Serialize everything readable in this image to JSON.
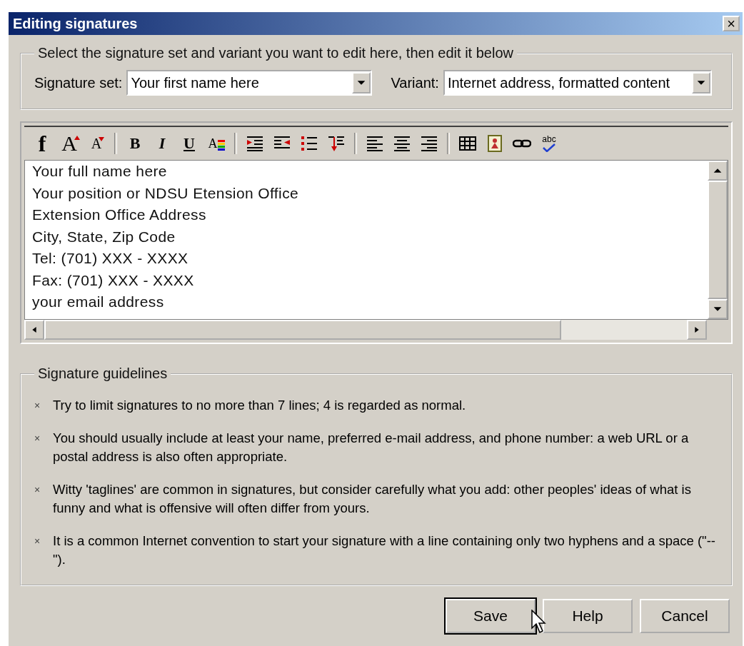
{
  "window": {
    "title": "Editing signatures",
    "close": "×"
  },
  "selection": {
    "legend": "Select the signature set and variant you want to edit here, then edit it below",
    "set_label": "Signature set:",
    "set_value": "Your first name here",
    "variant_label": "Variant:",
    "variant_value": "Internet address, formatted content"
  },
  "toolbar": [
    {
      "kind": "font",
      "label": "f"
    },
    {
      "kind": "grow",
      "label": "A"
    },
    {
      "kind": "shrink",
      "label": "A"
    },
    {
      "kind": "sep"
    },
    {
      "kind": "bold",
      "label": "B"
    },
    {
      "kind": "italic",
      "label": "I"
    },
    {
      "kind": "underline",
      "label": "U"
    },
    {
      "kind": "color",
      "label": "A"
    },
    {
      "kind": "sep"
    },
    {
      "kind": "indent"
    },
    {
      "kind": "outdent"
    },
    {
      "kind": "bullets"
    },
    {
      "kind": "break"
    },
    {
      "kind": "sep"
    },
    {
      "kind": "align-left"
    },
    {
      "kind": "align-center"
    },
    {
      "kind": "align-right"
    },
    {
      "kind": "sep"
    },
    {
      "kind": "table"
    },
    {
      "kind": "image"
    },
    {
      "kind": "link"
    },
    {
      "kind": "spell",
      "label": "abc"
    }
  ],
  "editor_lines": [
    "Your full name here",
    "Your position or NDSU Etension Office",
    "Extension Office Address",
    "City, State,  Zip Code",
    "Tel: (701) XXX - XXXX",
    "Fax: (701) XXX - XXXX",
    "your email address"
  ],
  "guidelines": {
    "legend": "Signature guidelines",
    "items": [
      {
        "bullet": "×",
        "text": "Try to limit signatures to no more than 7 lines; 4 is regarded as normal."
      },
      {
        "bullet": "×",
        "text": "You should usually include at least your name, preferred e-mail address, and phone number: a web URL or a postal address is also often appropriate."
      },
      {
        "bullet": "×",
        "text": "Witty 'taglines' are common in signatures, but consider carefully what you add: other peoples' ideas of what is funny and what is offensive will often differ from yours."
      },
      {
        "bullet": "×",
        "text": "It is a common Internet convention to start your signature with a line containing only two hyphens and a space (\"-- \")."
      }
    ]
  },
  "buttons": [
    {
      "label": "Save",
      "selected": true
    },
    {
      "label": "Help",
      "selected": false
    },
    {
      "label": "Cancel",
      "selected": false
    }
  ]
}
